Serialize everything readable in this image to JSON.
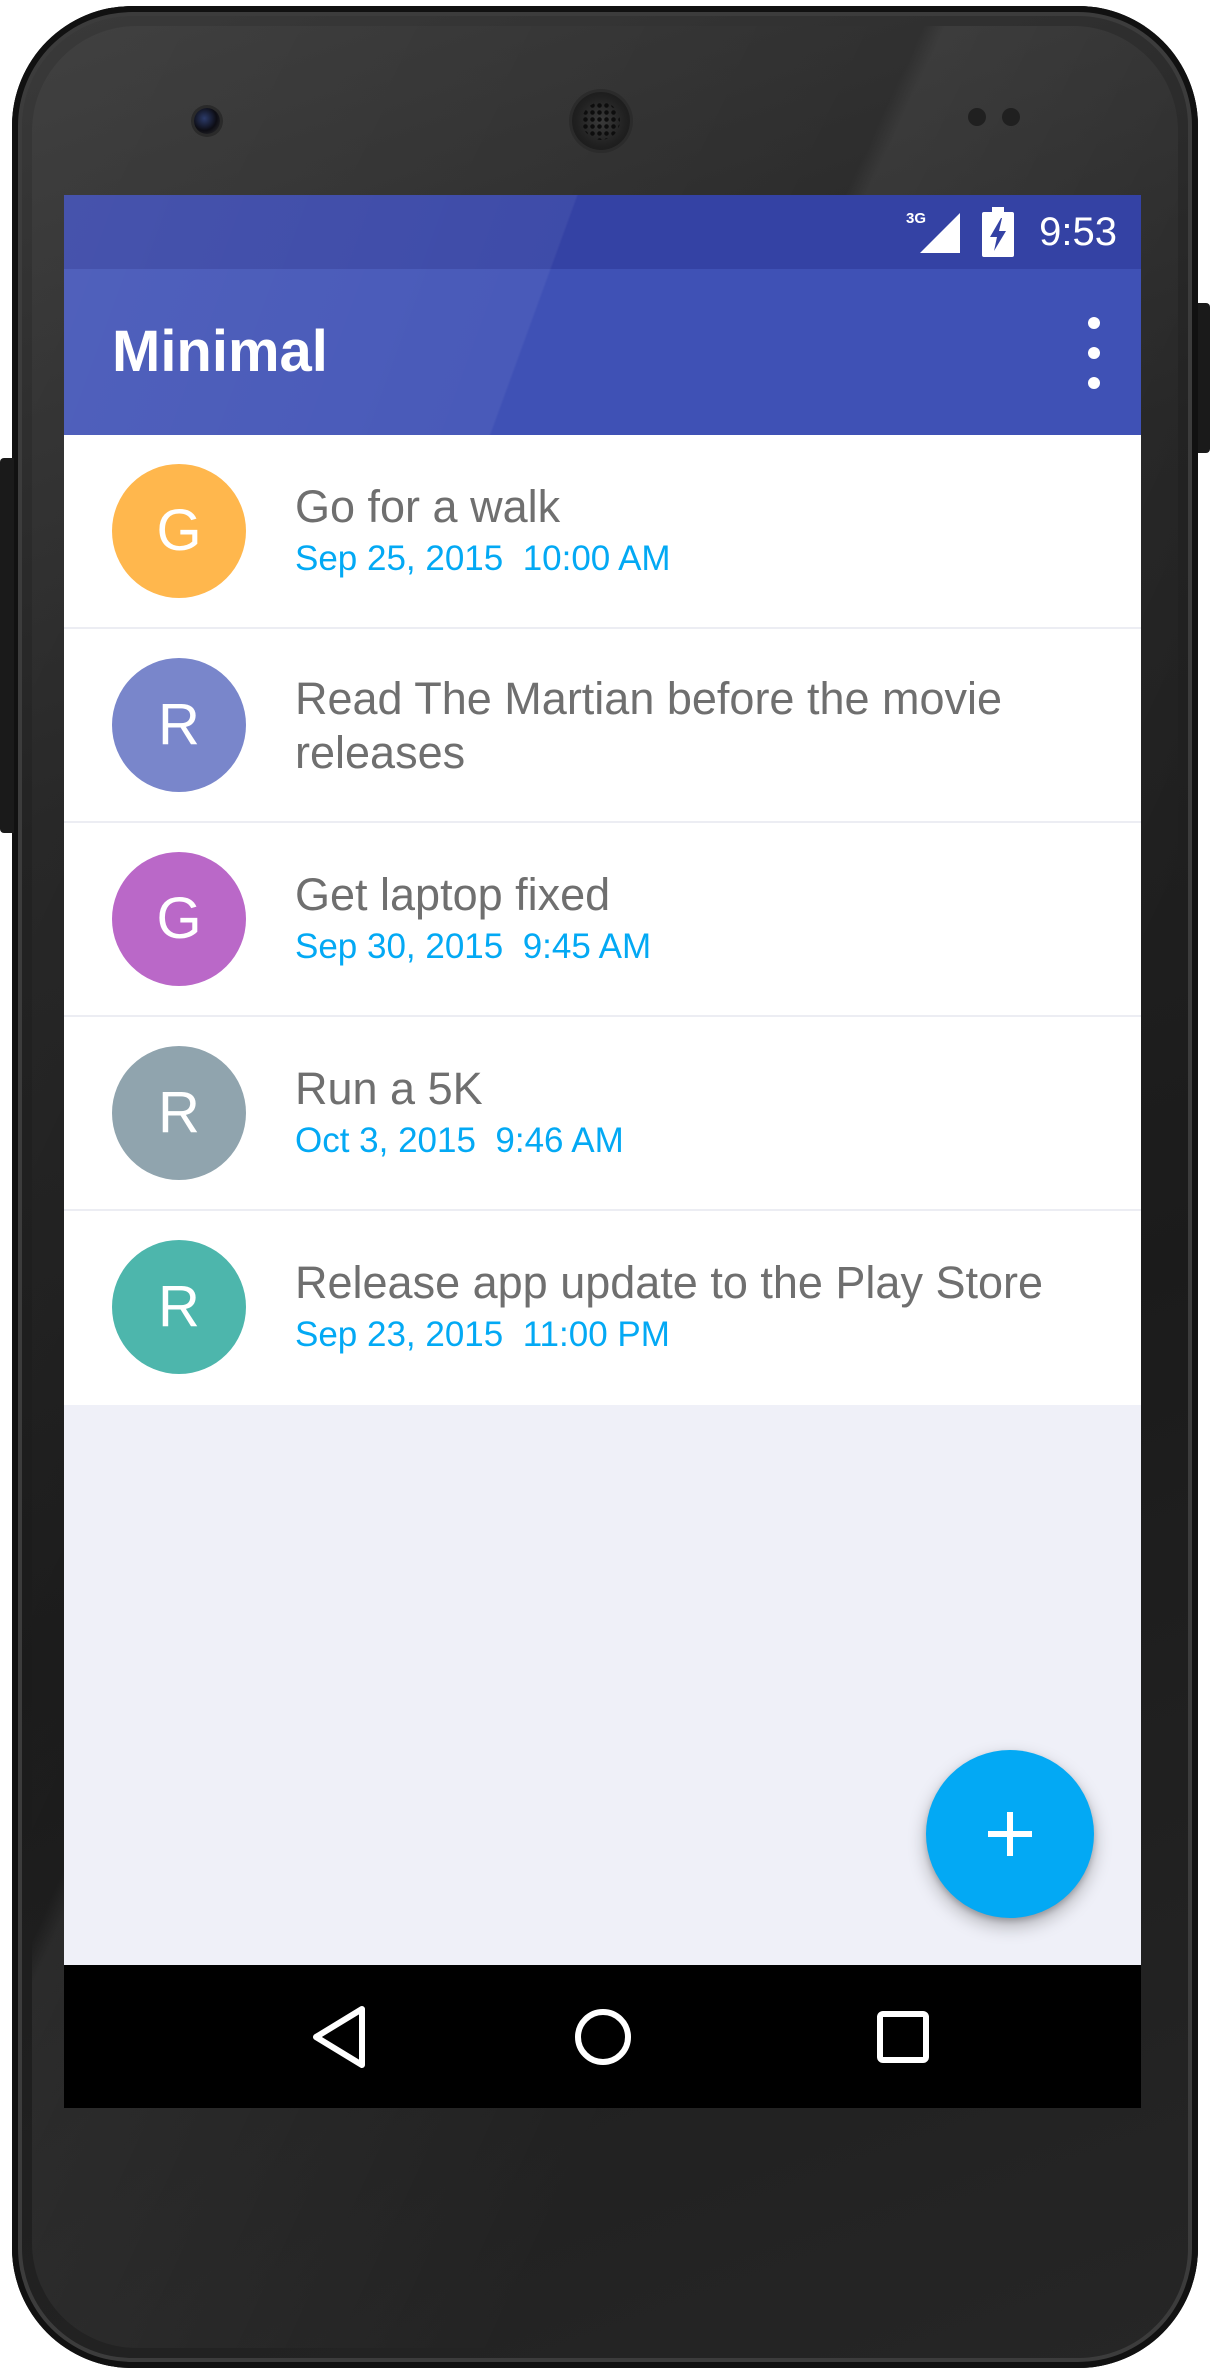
{
  "status_bar": {
    "network": "3G",
    "time": "9:53"
  },
  "app_bar": {
    "title": "Minimal",
    "overflow_icon": "more-vert-icon"
  },
  "tasks": [
    {
      "initial": "G",
      "title": "Go for a walk",
      "date": "Sep 25, 2015  10:00 AM",
      "color": "#ffb74d"
    },
    {
      "initial": "R",
      "title": "Read The Martian before the movie releases",
      "date": "",
      "color": "#7986cb"
    },
    {
      "initial": "G",
      "title": "Get laptop fixed",
      "date": "Sep 30, 2015  9:45 AM",
      "color": "#ba68c8"
    },
    {
      "initial": "R",
      "title": "Run a 5K",
      "date": "Oct 3, 2015  9:46 AM",
      "color": "#90a4ae"
    },
    {
      "initial": "R",
      "title": "Release app update to the Play Store",
      "date": "Sep 23, 2015  11:00 PM",
      "color": "#4db6ac"
    }
  ],
  "fab": {
    "icon": "plus-icon",
    "color": "#03a9f4"
  },
  "nav_bar": {
    "back": "back-icon",
    "home": "home-icon",
    "recents": "recents-icon"
  },
  "colors": {
    "primary": "#3f51b5",
    "primary_dark": "#3442a4",
    "accent": "#03a9f4",
    "background": "#eff0f8"
  }
}
